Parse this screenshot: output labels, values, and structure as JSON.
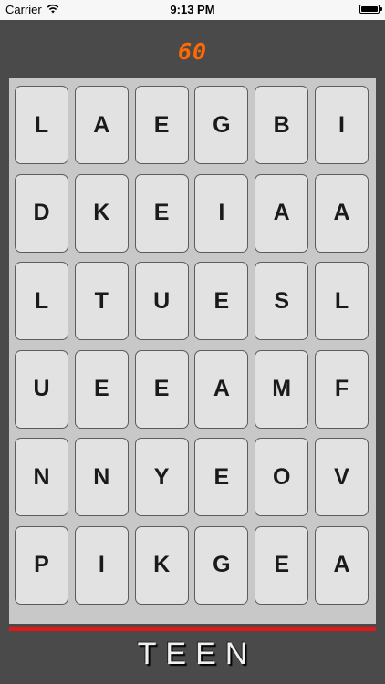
{
  "status_bar": {
    "carrier": "Carrier",
    "time": "9:13 PM",
    "battery_level": 1.0
  },
  "game": {
    "timer": "60",
    "current_word": "TEEN",
    "timer_color": "#ff6a00",
    "progress_color": "#e81515",
    "progress": 1.0
  },
  "board": {
    "rows": [
      [
        "L",
        "A",
        "E",
        "G",
        "B",
        "I"
      ],
      [
        "D",
        "K",
        "E",
        "I",
        "A",
        "A"
      ],
      [
        "L",
        "T",
        "U",
        "E",
        "S",
        "L"
      ],
      [
        "U",
        "E",
        "E",
        "A",
        "M",
        "F"
      ],
      [
        "N",
        "N",
        "Y",
        "E",
        "O",
        "V"
      ],
      [
        "P",
        "I",
        "K",
        "G",
        "E",
        "A"
      ]
    ]
  }
}
